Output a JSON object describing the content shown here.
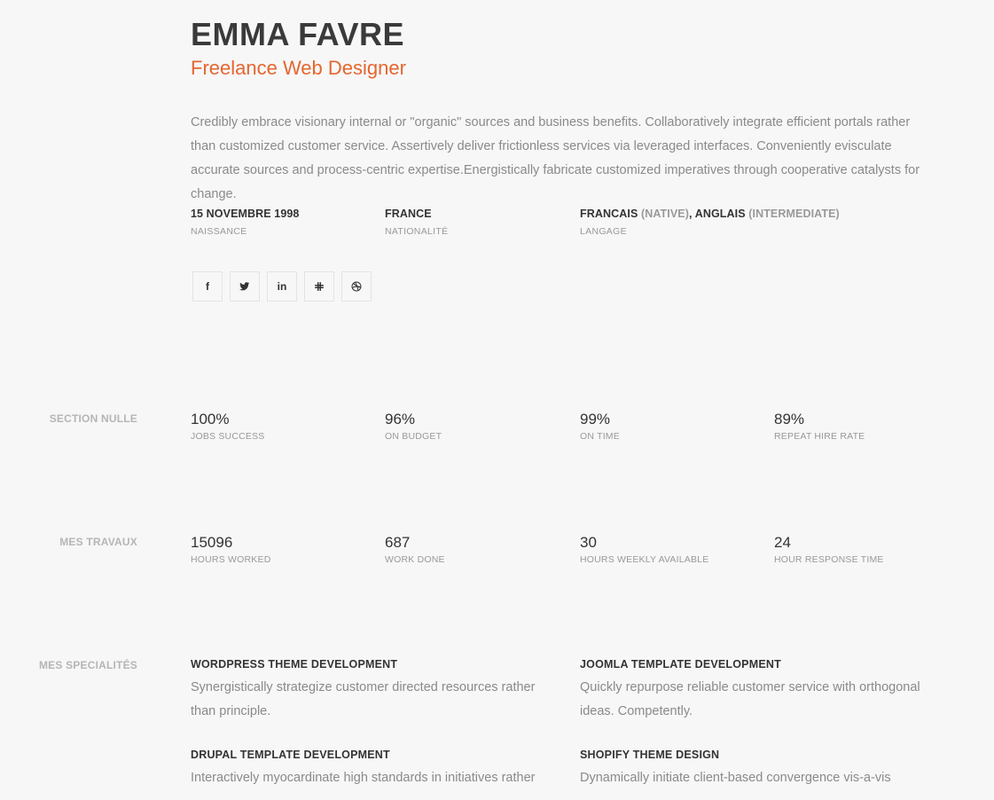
{
  "profile": {
    "name": "EMMA FAVRE",
    "title": "Freelance Web Designer",
    "intro": "Credibly embrace visionary internal or \"organic\" sources and business benefits. Collaboratively integrate efficient portals rather than customized customer service. Assertively deliver frictionless services via leveraged interfaces. Conveniently evisculate accurate sources and process-centric expertise.Energistically fabricate customized imperatives through cooperative catalysts for change."
  },
  "info": {
    "birth": {
      "value": "15 NOVEMBRE 1998",
      "label": "NAISSANCE"
    },
    "nationality": {
      "value": "FRANCE",
      "label": "NATIONALITÉ"
    },
    "language": {
      "lang1": "FRANCAIS",
      "level1": "(NATIVE)",
      "sep": ",",
      "lang2": "ANGLAIS",
      "level2": "(INTERMEDIATE)",
      "label": "LANGAGE"
    }
  },
  "socials": [
    {
      "icon": "facebook-icon",
      "glyph": "f"
    },
    {
      "icon": "twitter-icon"
    },
    {
      "icon": "linkedin-icon",
      "glyph": "in"
    },
    {
      "icon": "slack-icon"
    },
    {
      "icon": "dribbble-icon"
    }
  ],
  "sections": {
    "section_nulle": {
      "label": "SECTION NULLE",
      "stats": [
        {
          "value": "100%",
          "label": "JOBS SUCCESS"
        },
        {
          "value": "96%",
          "label": "ON BUDGET"
        },
        {
          "value": "99%",
          "label": "ON TIME"
        },
        {
          "value": "89%",
          "label": "REPEAT HIRE RATE"
        }
      ]
    },
    "mes_travaux": {
      "label": "MES TRAVAUX",
      "stats": [
        {
          "value": "15096",
          "label": "HOURS WORKED"
        },
        {
          "value": "687",
          "label": "WORK DONE"
        },
        {
          "value": "30",
          "label": "HOURS WEEKLY AVAILABLE"
        },
        {
          "value": "24",
          "label": "HOUR RESPONSE TIME"
        }
      ]
    },
    "specialites": {
      "label": "MES SPECIALITÉS",
      "items": [
        {
          "title": "WORDPRESS THEME DEVELOPMENT",
          "desc": "Synergistically strategize customer directed resources rather than principle."
        },
        {
          "title": "JOOMLA TEMPLATE DEVELOPMENT",
          "desc": "Quickly repurpose reliable customer service with orthogonal ideas. Competently."
        },
        {
          "title": "DRUPAL TEMPLATE DEVELOPMENT",
          "desc": "Interactively myocardinate high standards in initiatives rather"
        },
        {
          "title": "SHOPIFY THEME DESIGN",
          "desc": "Dynamically initiate client-based convergence vis-a-vis"
        }
      ]
    }
  },
  "colors": {
    "accent": "#e5662f",
    "background": "#f7f7f7",
    "text": "#333333",
    "muted": "#8a8a8a"
  }
}
